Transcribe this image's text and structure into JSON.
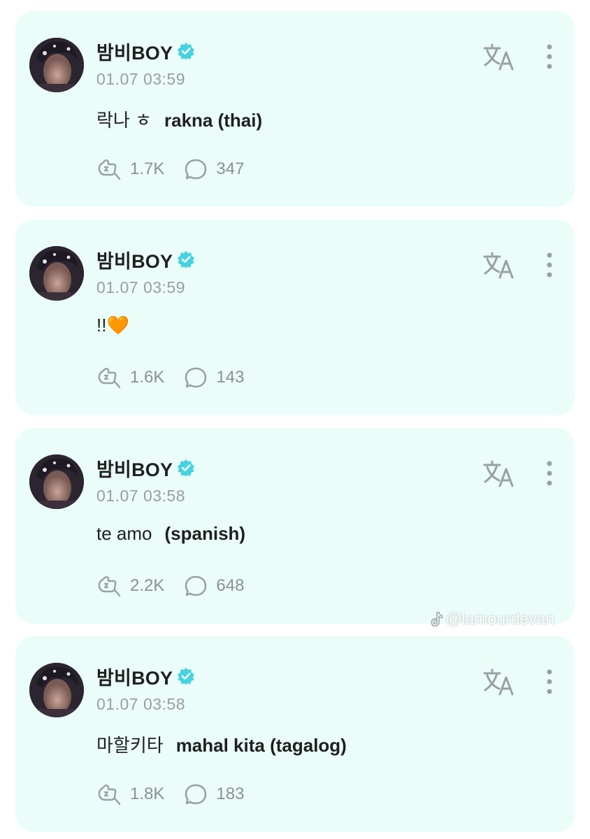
{
  "colors": {
    "card_bg": "#eafdf9",
    "verified": "#46d3e0",
    "icon_gray": "#9aa0a6",
    "text_primary": "#1f1f1f",
    "text_secondary": "#9a9ea3"
  },
  "icons": {
    "verified": "verified-badge-icon",
    "translate": "translate-icon",
    "more": "more-vertical-icon",
    "reaction": "reaction-icon",
    "comment": "comment-icon",
    "tiktok": "tiktok-icon"
  },
  "posts": [
    {
      "author": "밤비BOY",
      "timestamp": "01.07 03:59",
      "native_text": "락나 ㅎ",
      "gloss_text": "rakna (thai)",
      "reactions": "1.7K",
      "comments": "347"
    },
    {
      "author": "밤비BOY",
      "timestamp": "01.07 03:59",
      "native_text": "!!🧡",
      "gloss_text": "",
      "reactions": "1.6K",
      "comments": "143"
    },
    {
      "author": "밤비BOY",
      "timestamp": "01.07 03:58",
      "native_text": "te amo",
      "gloss_text": "(spanish)",
      "reactions": "2.2K",
      "comments": "648"
    },
    {
      "author": "밤비BOY",
      "timestamp": "01.07 03:58",
      "native_text": "마할키타",
      "gloss_text": "mahal kita (tagalog)",
      "reactions": "1.8K",
      "comments": "183"
    }
  ],
  "watermark": "@lamourdevan"
}
